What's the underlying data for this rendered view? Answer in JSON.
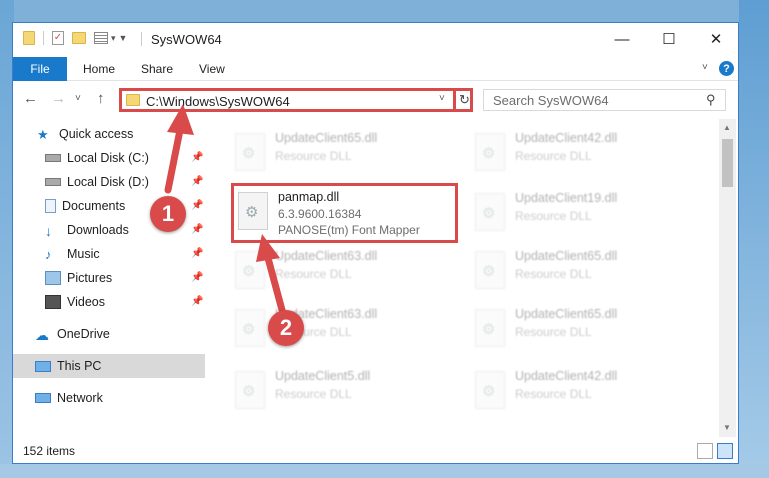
{
  "window": {
    "title": "SysWOW64",
    "minimize_glyph": "—",
    "maximize_glyph": "☐",
    "close_glyph": "✕"
  },
  "ribbon": {
    "file_label": "File",
    "tabs": [
      "Home",
      "Share",
      "View"
    ],
    "help_glyph": "?"
  },
  "nav": {
    "back_glyph": "←",
    "forward_glyph": "→",
    "recent_glyph": "˅",
    "up_glyph": "↑",
    "address": "C:\\Windows\\SysWOW64",
    "refresh_glyph": "↻",
    "search_placeholder": "Search SysWOW64"
  },
  "sidebar": {
    "items": [
      {
        "label": "Quick access",
        "icon": "star-icon"
      },
      {
        "label": "Local Disk (C:)",
        "icon": "drive-icon"
      },
      {
        "label": "Local Disk (D:)",
        "icon": "drive-icon"
      },
      {
        "label": "Documents",
        "icon": "documents-icon"
      },
      {
        "label": "Downloads",
        "icon": "downloads-icon"
      },
      {
        "label": "Music",
        "icon": "music-icon"
      },
      {
        "label": "Pictures",
        "icon": "pictures-icon"
      },
      {
        "label": "Videos",
        "icon": "videos-icon"
      },
      {
        "label": "OneDrive",
        "icon": "onedrive-icon"
      },
      {
        "label": "This PC",
        "icon": "pc-icon"
      },
      {
        "label": "Network",
        "icon": "network-icon"
      }
    ],
    "selected": "This PC"
  },
  "files": {
    "left_column": [
      {
        "name": "UpdateClient65.dll",
        "desc": "Resource DLL"
      },
      {
        "name": "UpdateClient63.dll",
        "desc": "Resource DLL"
      },
      {
        "name": "UpdateClient63.dll",
        "desc": "Resource DLL"
      },
      {
        "name": "UpdateClient5.dll",
        "desc": "Resource DLL"
      }
    ],
    "right_column": [
      {
        "name": "UpdateClient42.dll",
        "desc": "Resource DLL"
      },
      {
        "name": "UpdateClient19.dll",
        "desc": "Resource DLL"
      },
      {
        "name": "UpdateClient65.dll",
        "desc": "Resource DLL"
      },
      {
        "name": "UpdateClient65.dll",
        "desc": "Resource DLL"
      },
      {
        "name": "UpdateClient42.dll",
        "desc": "Resource DLL"
      }
    ],
    "highlighted": {
      "name": "panmap.dll",
      "version": "6.3.9600.16384",
      "desc": "PANOSE(tm) Font Mapper"
    }
  },
  "status": {
    "item_count": "152 items"
  },
  "annotations": {
    "step1": "1",
    "step2": "2"
  },
  "colors": {
    "accent": "#1979ca",
    "highlight_red": "#d94a4a",
    "selected_bg": "#d9d9d9"
  }
}
